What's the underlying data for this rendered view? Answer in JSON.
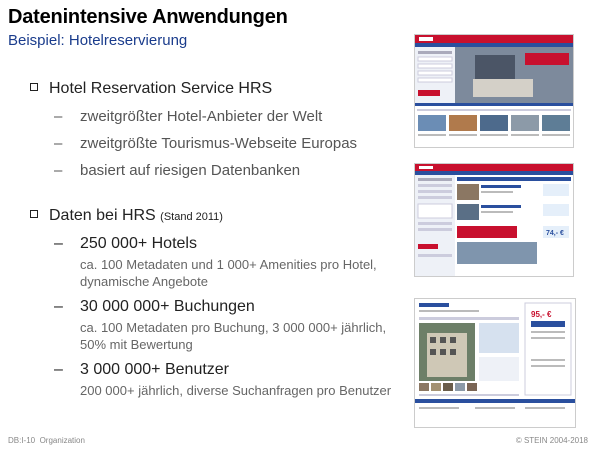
{
  "title": "Datenintensive Anwendungen",
  "subtitle": "Beispiel: Hotelreservierung",
  "section1": {
    "heading": "Hotel Reservation Service HRS",
    "items": [
      "zweitgrößter Hotel-Anbieter der Welt",
      "zweitgrößte Tourismus-Webseite Europas",
      "basiert auf riesigen Datenbanken"
    ]
  },
  "section2": {
    "heading": "Daten bei HRS",
    "heading_note": "(Stand 2011)",
    "items": [
      {
        "main": "250 000+ Hotels",
        "sub": "ca. 100 Metadaten und 1 000+ Amenities pro Hotel, dynamische Angebote"
      },
      {
        "main": "30 000 000+ Buchungen",
        "sub": "ca. 100 Metadaten pro Buchung, 3 000 000+ jährlich, 50% mit Bewertung"
      },
      {
        "main": "3 000 000+ Benutzer",
        "sub": "200 000+ jährlich, diverse Suchanfragen pro Benutzer"
      }
    ]
  },
  "footer": {
    "left_code": "DB:I-10",
    "left_label": "Organization",
    "right": "© STEIN 2004-2018"
  },
  "thumb2": {
    "price": "74,- €"
  },
  "thumb3": {
    "price": "95,- €"
  },
  "colors": {
    "title": "#000000",
    "subtitle": "#1a3c8c",
    "hrs_red": "#c8102e",
    "hrs_blue": "#2a4f9e"
  }
}
